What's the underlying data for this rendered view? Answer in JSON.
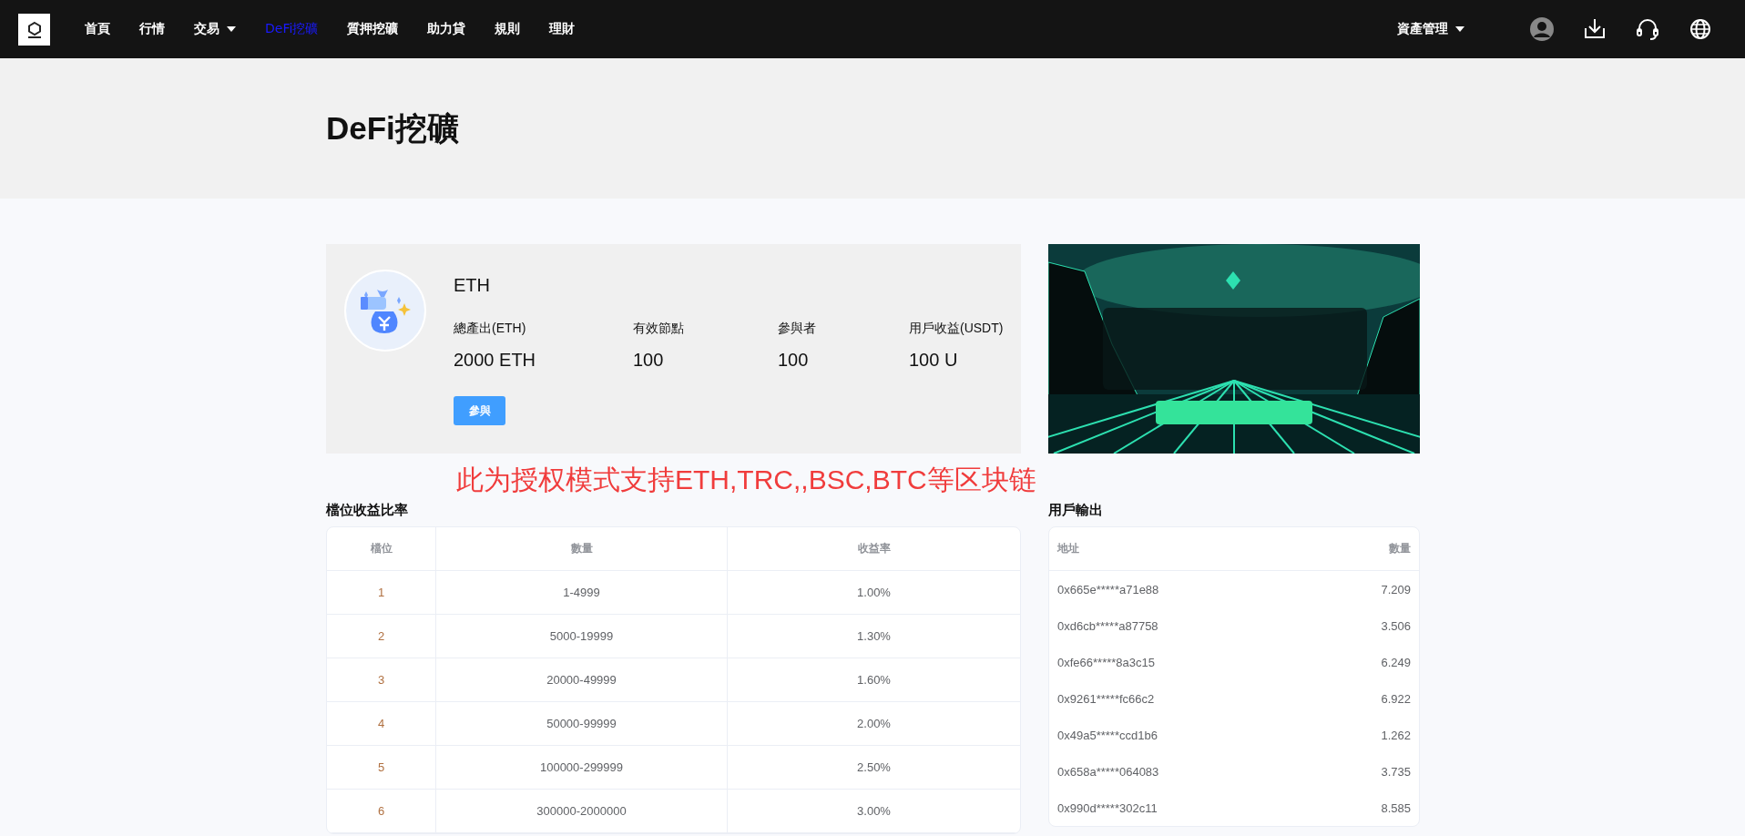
{
  "nav": {
    "items": [
      {
        "label": "首頁",
        "selected": false,
        "dropdown": false
      },
      {
        "label": "行情",
        "selected": false,
        "dropdown": false
      },
      {
        "label": "交易",
        "selected": false,
        "dropdown": true
      },
      {
        "label": "DeFi挖礦",
        "selected": true,
        "dropdown": false
      },
      {
        "label": "質押挖礦",
        "selected": false,
        "dropdown": false
      },
      {
        "label": "助力貸",
        "selected": false,
        "dropdown": false
      },
      {
        "label": "規則",
        "selected": false,
        "dropdown": false
      },
      {
        "label": "理財",
        "selected": false,
        "dropdown": false
      }
    ],
    "asset_menu": "資產管理"
  },
  "page_title": "DeFi挖礦",
  "pool": {
    "name": "ETH",
    "button": "參與",
    "stats": [
      {
        "label": "總產出(ETH)",
        "value": "2000 ETH"
      },
      {
        "label": "有效節點",
        "value": "100"
      },
      {
        "label": "參與者",
        "value": "100"
      },
      {
        "label": "用戶收益(USDT)",
        "value": "100 U"
      }
    ]
  },
  "notice": "此为授权模式支持ETH,TRC,,BSC,BTC等区块链",
  "rates": {
    "title": "檔位收益比率",
    "columns": [
      "檔位",
      "數量",
      "收益率"
    ],
    "rows": [
      [
        "1",
        "1-4999",
        "1.00%"
      ],
      [
        "2",
        "5000-19999",
        "1.30%"
      ],
      [
        "3",
        "20000-49999",
        "1.60%"
      ],
      [
        "4",
        "50000-99999",
        "2.00%"
      ],
      [
        "5",
        "100000-299999",
        "2.50%"
      ],
      [
        "6",
        "300000-2000000",
        "3.00%"
      ]
    ]
  },
  "outputs": {
    "title": "用戶輸出",
    "columns": [
      "地址",
      "數量"
    ],
    "rows": [
      [
        "0x665e*****a71e88",
        "7.209"
      ],
      [
        "0xd6cb*****a87758",
        "3.506"
      ],
      [
        "0xfe66*****8a3c15",
        "6.249"
      ],
      [
        "0x9261*****fc66c2",
        "6.922"
      ],
      [
        "0x49a5*****ccd1b6",
        "1.262"
      ],
      [
        "0x658a*****064083",
        "3.735"
      ],
      [
        "0x990d*****302c11",
        "8.585"
      ]
    ]
  }
}
